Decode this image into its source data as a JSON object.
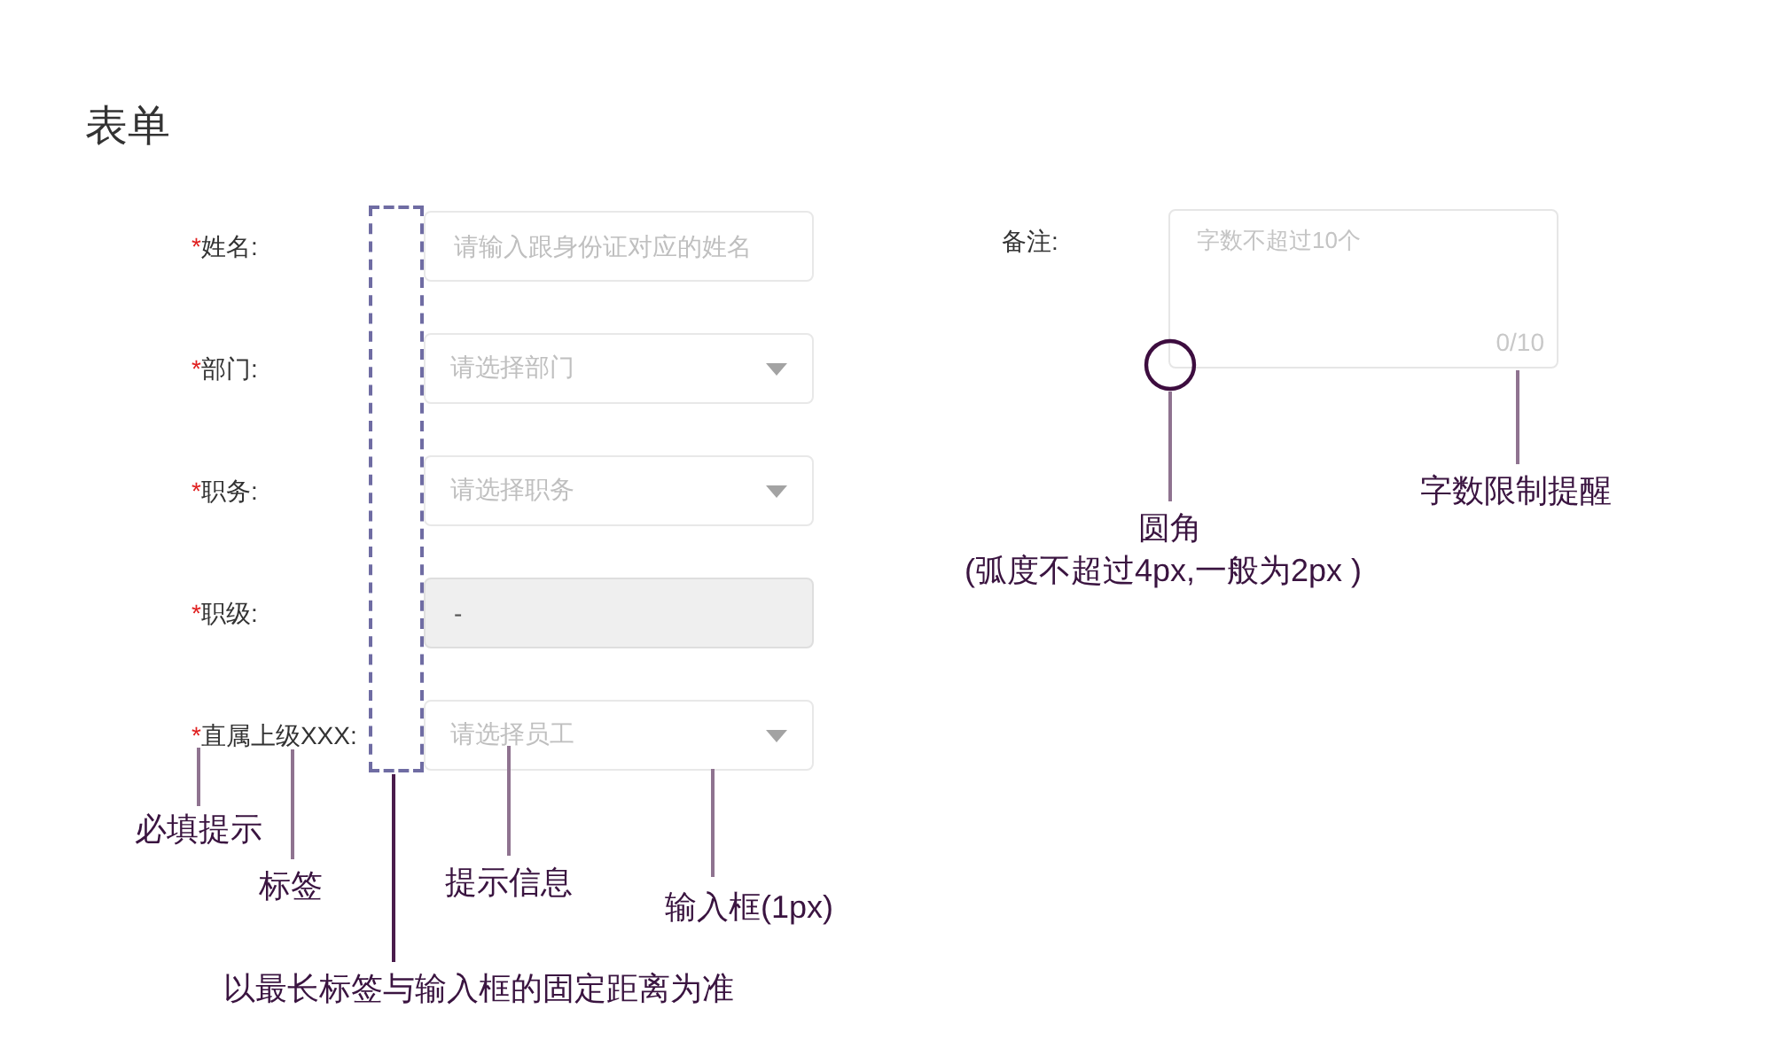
{
  "title": "表单",
  "fields": [
    {
      "kind": "input",
      "required_mark": "*",
      "label": "姓名:",
      "placeholder": "请输入跟身份证对应的姓名",
      "disabled": false
    },
    {
      "kind": "select",
      "required_mark": "*",
      "label": "部门:",
      "placeholder": "请选择部门",
      "disabled": false
    },
    {
      "kind": "select",
      "required_mark": "*",
      "label": "职务:",
      "placeholder": "请选择职务",
      "disabled": false
    },
    {
      "kind": "input",
      "required_mark": "*",
      "label": "职级:",
      "value": "-",
      "disabled": true
    },
    {
      "kind": "select",
      "required_mark": "*",
      "label": "直属上级XXX:",
      "placeholder": "请选择员工",
      "disabled": false
    }
  ],
  "remark": {
    "label": "备注:",
    "placeholder": "字数不超过10个",
    "counter": "0/10"
  },
  "annotations": [
    {
      "kind": "mark",
      "text": "必填提示"
    },
    {
      "kind": "label",
      "text": "标签"
    },
    {
      "kind": "hint",
      "text": "提示信息"
    },
    {
      "kind": "border",
      "text": "输入框(1px)"
    },
    {
      "kind": "spacing",
      "text": "以最长标签与输入框的固定距离为准"
    },
    {
      "kind": "corner",
      "text": "圆角",
      "note": "(弧度不超过4px,一般为2px )"
    },
    {
      "kind": "counter",
      "text": "字数限制提醒"
    }
  ]
}
